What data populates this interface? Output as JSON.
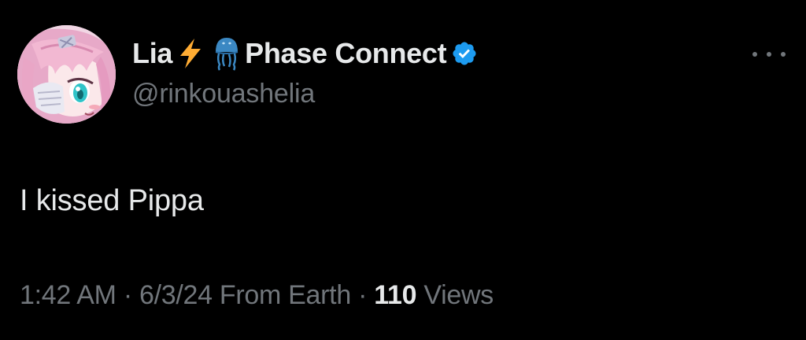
{
  "author": {
    "name": "Lia",
    "affiliation": "Phase Connect",
    "handle": "@rinkouashelia",
    "verified": true,
    "name_emojis": [
      "lightning-icon",
      "jellyfish-icon"
    ],
    "avatar": "anime-girl-avatar"
  },
  "tweet": {
    "text": "I kissed Pippa"
  },
  "meta": {
    "time": "1:42 AM",
    "separator": "·",
    "date": "6/3/24",
    "source": "From Earth",
    "views_count": "110",
    "views_label": "Views"
  },
  "colors": {
    "background": "#000000",
    "primary_text": "#e7e9ea",
    "secondary_text": "#71767b",
    "verified_badge": "#1d9bf0",
    "lightning": "#ffac33",
    "jellyfish": "#3b88c3"
  }
}
